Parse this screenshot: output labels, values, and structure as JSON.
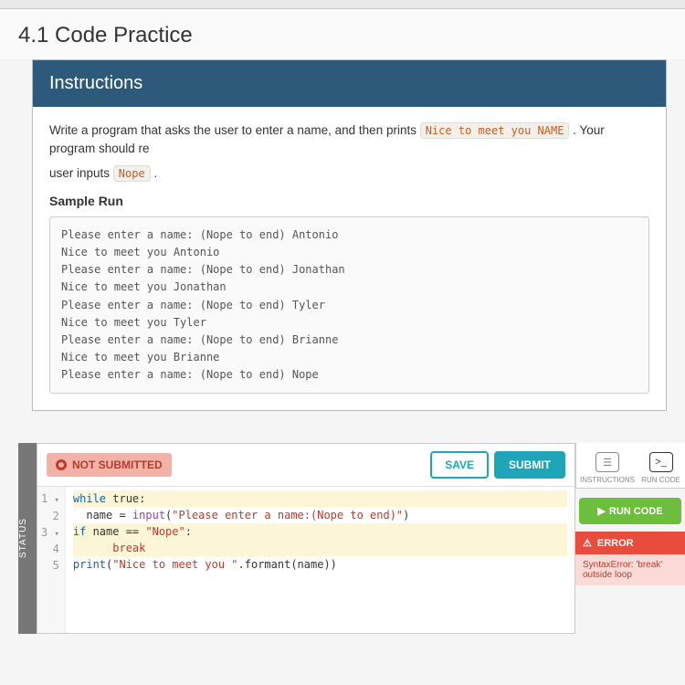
{
  "page": {
    "title": "4.1 Code Practice"
  },
  "instructions": {
    "header": "Instructions",
    "text_before": "Write a program that asks the user to enter a name, and then prints ",
    "inline1": "Nice to meet you NAME",
    "text_mid": ". Your program should re",
    "text_line2a": "user inputs ",
    "inline2": "Nope",
    "text_line2b": ".",
    "sample_title": "Sample Run",
    "sample_output": "Please enter a name: (Nope to end) Antonio\nNice to meet you Antonio\nPlease enter a name: (Nope to end) Jonathan\nNice to meet you Jonathan\nPlease enter a name: (Nope to end) Tyler\nNice to meet you Tyler\nPlease enter a name: (Nope to end) Brianne\nNice to meet you Brianne\nPlease enter a name: (Nope to end) Nope"
  },
  "status": {
    "rail": "STATUS",
    "label": "NOT SUBMITTED"
  },
  "toolbar": {
    "save": "SAVE",
    "submit": "SUBMIT"
  },
  "code": {
    "lines": [
      "1",
      "2",
      "3",
      "4",
      "5"
    ],
    "l1_kw": "while",
    "l1_rest": " true:",
    "l2_a": "  name = ",
    "l2_fn": "input",
    "l2_b": "(",
    "l2_str": "\"Please enter a name:(Nope to end)\"",
    "l2_c": ")",
    "l3_kw": "if",
    "l3_rest": " name == ",
    "l3_str": "\"Nope\"",
    "l3_c": ":",
    "l4": "      break",
    "l5_a": "print",
    "l5_b": "(",
    "l5_str": "\"Nice to meet you \"",
    "l5_c": ".formant(name))"
  },
  "right": {
    "tab1": "INSTRUCTIONS",
    "tab2": "RUN CODE",
    "run": "RUN CODE",
    "err_title": "ERROR",
    "err_detail": "SyntaxError: 'break' outside loop"
  }
}
